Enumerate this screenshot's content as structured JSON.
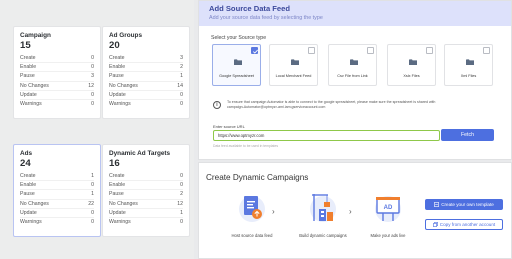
{
  "stats": [
    {
      "title": "Campaign",
      "total": "15",
      "rows": [
        {
          "label": "Create",
          "value": "0"
        },
        {
          "label": "Enable",
          "value": "0"
        },
        {
          "label": "Pause",
          "value": "3"
        },
        {
          "label": "No Changes",
          "value": "12"
        },
        {
          "label": "Update",
          "value": "0"
        },
        {
          "label": "Warnings",
          "value": "0"
        }
      ]
    },
    {
      "title": "Ad Groups",
      "total": "20",
      "rows": [
        {
          "label": "Create",
          "value": "3"
        },
        {
          "label": "Enable",
          "value": "2"
        },
        {
          "label": "Pause",
          "value": "1"
        },
        {
          "label": "No Changes",
          "value": "14"
        },
        {
          "label": "Update",
          "value": "0"
        },
        {
          "label": "Warnings",
          "value": "0"
        }
      ]
    },
    {
      "title": "Ads",
      "total": "24",
      "rows": [
        {
          "label": "Create",
          "value": "1"
        },
        {
          "label": "Enable",
          "value": "0"
        },
        {
          "label": "Pause",
          "value": "1"
        },
        {
          "label": "No Changes",
          "value": "22"
        },
        {
          "label": "Update",
          "value": "0"
        },
        {
          "label": "Warnings",
          "value": "0"
        }
      ]
    },
    {
      "title": "Dynamic Ad Targets",
      "total": "16",
      "rows": [
        {
          "label": "Create",
          "value": "0"
        },
        {
          "label": "Enable",
          "value": "0"
        },
        {
          "label": "Pause",
          "value": "2"
        },
        {
          "label": "No Changes",
          "value": "12"
        },
        {
          "label": "Update",
          "value": "1"
        },
        {
          "label": "Warnings",
          "value": "0"
        }
      ]
    }
  ],
  "feed": {
    "title": "Add Source Data Feed",
    "subtitle": "Add your source data feed by selecting the type",
    "source_type_label": "Select your Source type",
    "types": [
      {
        "label": "Google Spreadsheet",
        "selected": true
      },
      {
        "label": "Local Merchant Feed",
        "selected": false
      },
      {
        "label": "Csv File from Link",
        "selected": false
      },
      {
        "label": "Xslx Files",
        "selected": false
      },
      {
        "label": "Xml Files",
        "selected": false
      }
    ],
    "info_line1": "To ensure that campaign Automator is able to connect to the google spreadsheet, please make sure the spreadsheet is shared with",
    "info_line2": "campaign-Automator@optmyzr-ami.iam.gserviceaccount.com",
    "url_label": "Enter source URL",
    "url_value": "https://www.optmyzr.com",
    "fetch_label": "Fetch",
    "url_help": "Data feed available to be used in templates"
  },
  "create": {
    "title": "Create Dynamic Campaigns",
    "steps": [
      {
        "label": "Host source data feed",
        "icon": "document-upload-icon"
      },
      {
        "label": "Build dynamic campaigns",
        "icon": "build-blocks-icon"
      },
      {
        "label": "Make your ads live",
        "icon": "ad-billboard-icon"
      }
    ],
    "primary_button": "Create your own template",
    "secondary_button": "Copy from another account"
  },
  "colors": {
    "accent": "#4d6fe0",
    "header_bg": "#dde1fb",
    "input_border": "#8fc84a",
    "orange": "#f07f2e"
  }
}
